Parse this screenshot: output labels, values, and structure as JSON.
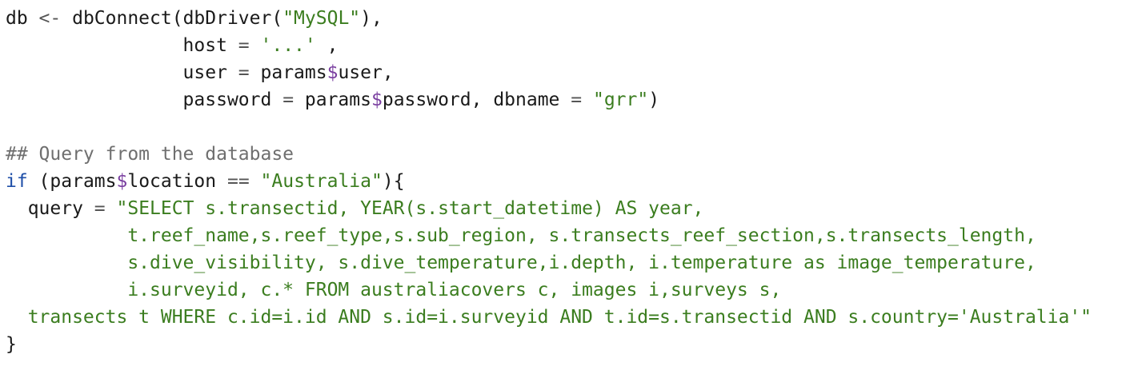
{
  "editor": {
    "colors": {
      "background": "#ffffff",
      "text": "#1a1a1a",
      "string": "#3b7d1f",
      "operator": "#555555",
      "comment": "#6f6f6f",
      "keyword": "#1f4fa8",
      "dollar": "#7a3fa0"
    },
    "lines": [
      [
        {
          "t": "db ",
          "k": "plain"
        },
        {
          "t": "<-",
          "k": "op"
        },
        {
          "t": " dbConnect(dbDriver(",
          "k": "plain"
        },
        {
          "t": "\"MySQL\"",
          "k": "str"
        },
        {
          "t": "),",
          "k": "plain"
        }
      ],
      [
        {
          "t": "                host ",
          "k": "plain"
        },
        {
          "t": "=",
          "k": "op"
        },
        {
          "t": " ",
          "k": "plain"
        },
        {
          "t": "'...'",
          "k": "str"
        },
        {
          "t": " ,",
          "k": "plain"
        }
      ],
      [
        {
          "t": "                user ",
          "k": "plain"
        },
        {
          "t": "=",
          "k": "op"
        },
        {
          "t": " params",
          "k": "plain"
        },
        {
          "t": "$",
          "k": "var"
        },
        {
          "t": "user,",
          "k": "plain"
        }
      ],
      [
        {
          "t": "                password ",
          "k": "plain"
        },
        {
          "t": "=",
          "k": "op"
        },
        {
          "t": " params",
          "k": "plain"
        },
        {
          "t": "$",
          "k": "var"
        },
        {
          "t": "password, dbname ",
          "k": "plain"
        },
        {
          "t": "=",
          "k": "op"
        },
        {
          "t": " ",
          "k": "plain"
        },
        {
          "t": "\"grr\"",
          "k": "str"
        },
        {
          "t": ")",
          "k": "plain"
        }
      ],
      [
        {
          "t": "",
          "k": "plain"
        }
      ],
      [
        {
          "t": "## Query from the database",
          "k": "com"
        }
      ],
      [
        {
          "t": "if",
          "k": "kw"
        },
        {
          "t": " (params",
          "k": "plain"
        },
        {
          "t": "$",
          "k": "var"
        },
        {
          "t": "location ",
          "k": "plain"
        },
        {
          "t": "==",
          "k": "op"
        },
        {
          "t": " ",
          "k": "plain"
        },
        {
          "t": "\"Australia\"",
          "k": "str"
        },
        {
          "t": "){",
          "k": "plain"
        }
      ],
      [
        {
          "t": "  query ",
          "k": "plain"
        },
        {
          "t": "=",
          "k": "op"
        },
        {
          "t": " ",
          "k": "plain"
        },
        {
          "t": "\"SELECT s.transectid, YEAR(s.start_datetime) AS year,",
          "k": "str"
        }
      ],
      [
        {
          "t": "           t.reef_name,s.reef_type,s.sub_region, s.transects_reef_section,s.transects_length,",
          "k": "str"
        }
      ],
      [
        {
          "t": "           s.dive_visibility, s.dive_temperature,i.depth, i.temperature as image_temperature,",
          "k": "str"
        }
      ],
      [
        {
          "t": "           i.surveyid, c.* FROM australiacovers c, images i,surveys s,",
          "k": "str"
        }
      ],
      [
        {
          "t": "  transects t WHERE c.id=i.id AND s.id=i.surveyid AND t.id=s.transectid AND s.country='Australia'\"",
          "k": "str"
        }
      ],
      [
        {
          "t": "}",
          "k": "plain"
        }
      ]
    ]
  }
}
